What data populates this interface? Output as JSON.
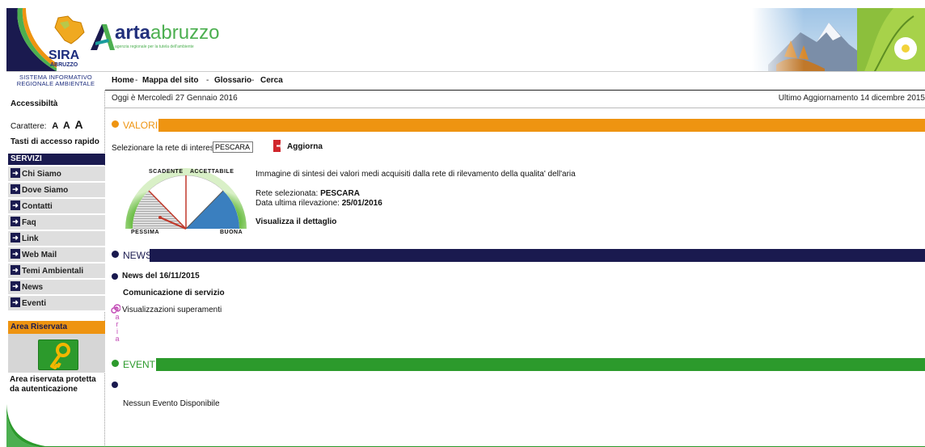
{
  "header": {
    "sira_logo_text": "SIRA",
    "sira_logo_sub": "ABRUZZO",
    "system_name_line1": "SISTEMA INFORMATIVO",
    "system_name_line2": "REGIONALE AMBIENTALE",
    "arta_brand_bold": "arta",
    "arta_brand_light": "abruzzo",
    "arta_tagline": "agenzia regionale per la tutela dell'ambiente"
  },
  "nav": {
    "items": [
      "Home",
      "Mappa del sito",
      "Glossario",
      "Cerca"
    ],
    "separator": "-"
  },
  "datebar": {
    "today": "Oggi è Mercoledì 27 Gennaio 2016",
    "last_update": "Ultimo Aggiornamento 14 dicembre 2015"
  },
  "sidebar": {
    "accessibility": "Accessibiltà",
    "font_size_label": "Carattere:",
    "font_sizes": [
      "A",
      "A",
      "A"
    ],
    "quick_keys": "Tasti di accesso rapido",
    "services_head": "SERVIZI",
    "items": [
      "Chi Siamo",
      "Dove Siamo",
      "Contatti",
      "Faq",
      "Link",
      "Web Mail",
      "Temi Ambientali",
      "News",
      "Eventi"
    ],
    "reserved_head": "Area Riservata",
    "reserved_text": "Area riservata protetta da autenticazione"
  },
  "valori": {
    "title": "VALORI",
    "select_label": "Selezionare la rete di interesse",
    "selected_network": "PESCARA",
    "refresh_label": "Aggiorna",
    "gauge_labels": {
      "top_left": "SCADENTE",
      "top_right": "ACCETTABILE",
      "bottom_left": "PESSIMA",
      "bottom_right": "BUONA"
    },
    "description": "Immagine di sintesi dei valori medi acquisiti dalla rete di rilevamento della qualita' dell'aria",
    "network_label": "Rete selezionata:",
    "network_value": "PESCARA",
    "last_reading_label": "Data ultima rilevazione:",
    "last_reading_value": "25/01/2016",
    "detail_link": "Visualizza il dettaglio"
  },
  "news": {
    "title": "NEWS",
    "item_date": "News del 16/11/2015",
    "item_title": "Comunicazione di servizio",
    "link": "Visualizzazioni superamenti",
    "aria_letters": [
      "a",
      "r",
      "i",
      "a"
    ]
  },
  "eventi": {
    "title": "EVENTI",
    "empty_text": "Nessun Evento Disponibile"
  },
  "colors": {
    "navy": "#1a1a4f",
    "orange": "#ee9411",
    "green": "#2c9a2c",
    "gray": "#dedede"
  }
}
